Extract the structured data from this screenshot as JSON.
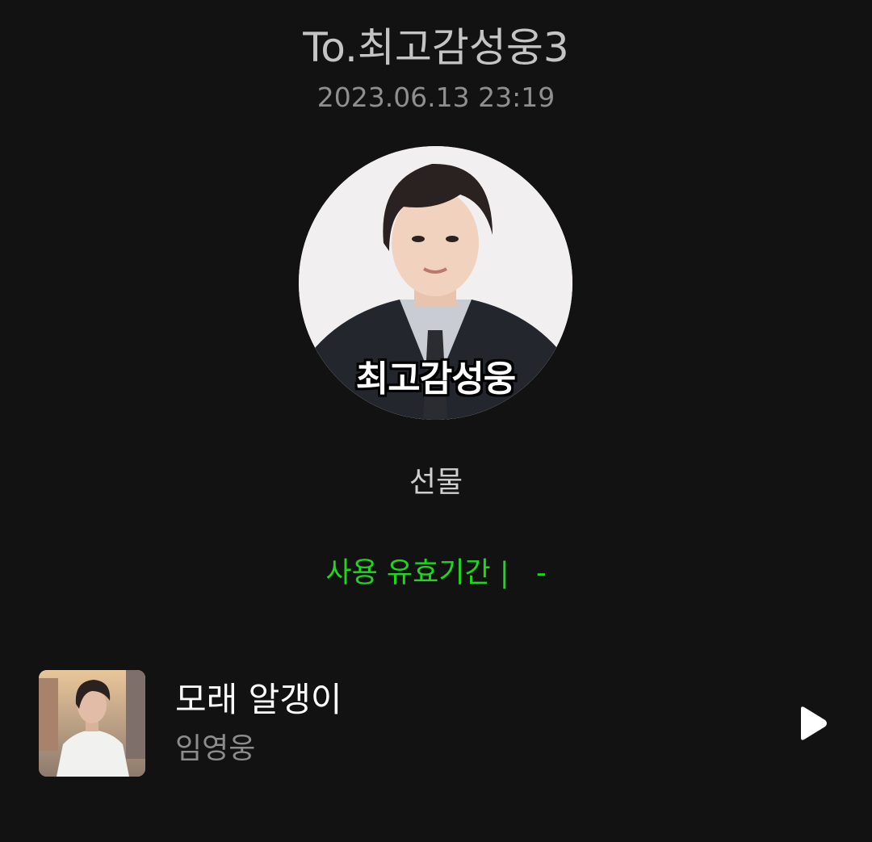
{
  "header": {
    "recipient": "To.최고감성웅3",
    "date": "2023.06.13 23:19"
  },
  "profile": {
    "caption": "최고감성웅"
  },
  "gift": {
    "label": "선물",
    "validity": "사용 유효기간 |   -"
  },
  "song": {
    "title": "모래 알갱이",
    "artist": "임영웅"
  },
  "colors": {
    "background": "#121212",
    "accent_green": "#1ed81e"
  },
  "icons": {
    "play": "play-icon"
  }
}
